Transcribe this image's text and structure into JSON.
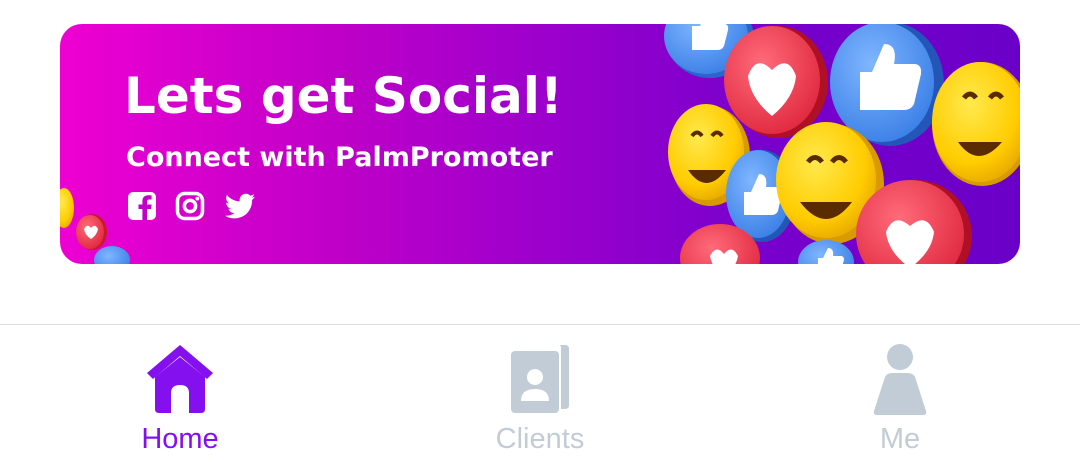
{
  "banner": {
    "title": "Lets get Social!",
    "subtitle": "Connect with PalmPromoter",
    "social_icons": [
      "facebook-icon",
      "instagram-icon",
      "twitter-icon"
    ],
    "gradient_colors": [
      "#ee00d2",
      "#9a00cc",
      "#6a00c8"
    ]
  },
  "tabbar": {
    "active_color": "#8410f0",
    "inactive_color": "#c2ccd6",
    "tabs": [
      {
        "label": "Home",
        "icon": "home-icon",
        "active": true
      },
      {
        "label": "Clients",
        "icon": "contacts-icon",
        "active": false
      },
      {
        "label": "Me",
        "icon": "person-icon",
        "active": false
      }
    ]
  }
}
